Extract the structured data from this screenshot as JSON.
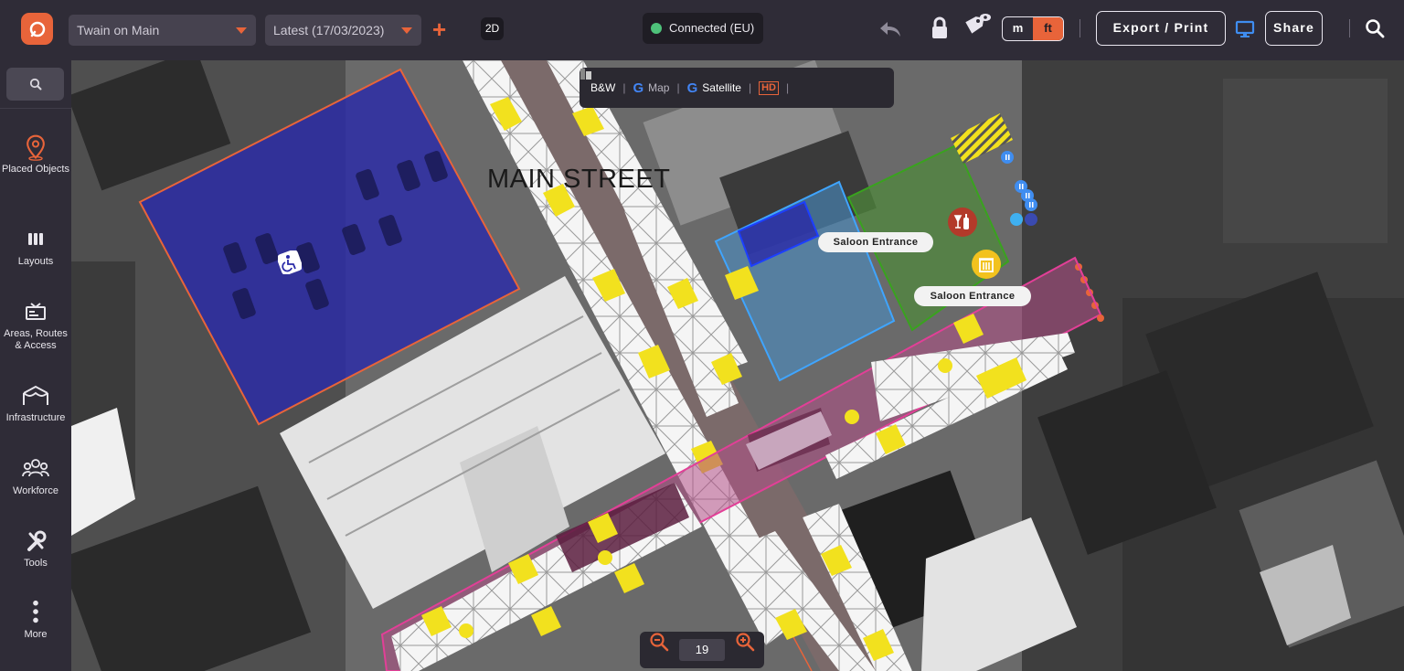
{
  "header": {
    "project_name": "Twain on Main",
    "version": "Latest (17/03/2023)",
    "add_label": "+",
    "view_mode": "2D",
    "connection_status": "Connected (EU)",
    "units": {
      "metric": "m",
      "imperial": "ft",
      "selected": "ft"
    },
    "export_label": "Export / Print",
    "share_label": "Share"
  },
  "sidebar": {
    "items": [
      {
        "label": "Placed Objects",
        "icon": "pin-icon"
      },
      {
        "label": "Layouts",
        "icon": "layouts-icon"
      },
      {
        "label": "Areas, Routes & Access",
        "icon": "areas-icon"
      },
      {
        "label": "Infrastructure",
        "icon": "tent-icon"
      },
      {
        "label": "Workforce",
        "icon": "people-icon"
      },
      {
        "label": "Tools",
        "icon": "tools-icon"
      },
      {
        "label": "More",
        "icon": "more-icon"
      }
    ]
  },
  "map": {
    "layer_options": [
      {
        "label": "B&W",
        "icon": "bw-icon"
      },
      {
        "label": "Map",
        "icon": "google-icon"
      },
      {
        "label": "Satellite",
        "icon": "google-icon"
      },
      {
        "label": "HD",
        "icon": "hd-icon"
      }
    ],
    "street_label": "MAIN STREET",
    "labels": [
      "Saloon Entrance",
      "Saloon Entrance"
    ],
    "zoom_level": "19",
    "colors": {
      "brand": "#e8643a",
      "parking_area": "#2b2ba8",
      "blue_area": "#4a8ec4",
      "green_area": "#4e8a3a",
      "route": "#d14a8e",
      "barrier_yellow": "#f2e11e",
      "barrier_white": "#f5f5f5"
    }
  }
}
